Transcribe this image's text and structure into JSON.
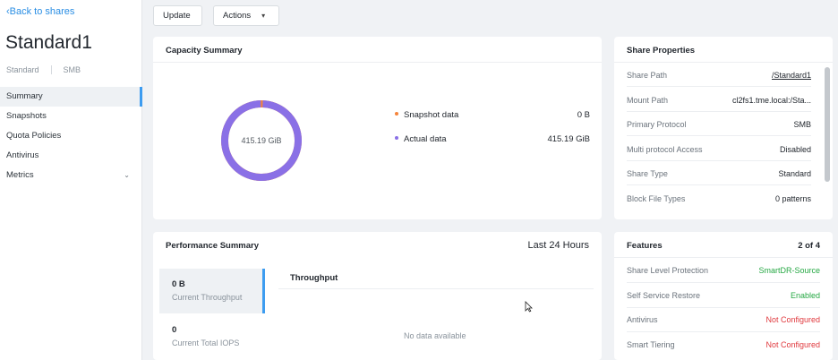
{
  "sidebar": {
    "back_label": "‹Back to shares",
    "title": "Standard1",
    "meta": [
      "Standard",
      "SMB"
    ],
    "items": [
      {
        "label": "Summary",
        "active": true
      },
      {
        "label": "Snapshots"
      },
      {
        "label": "Quota Policies"
      },
      {
        "label": "Antivirus"
      },
      {
        "label": "Metrics",
        "chevron": "chevron-down-icon"
      }
    ]
  },
  "toolbar": {
    "update_label": "Update",
    "actions_label": "Actions"
  },
  "capacity": {
    "title": "Capacity Summary",
    "total": "415.19 GiB",
    "legend": [
      {
        "label": "Snapshot data",
        "value": "0 B",
        "color": "#f5843b"
      },
      {
        "label": "Actual data",
        "value": "415.19 GiB",
        "color": "#8a70e6"
      }
    ],
    "actual_fraction": 1.0
  },
  "properties": {
    "title": "Share Properties",
    "rows": [
      {
        "label": "Share Path",
        "value": "/Standard1"
      },
      {
        "label": "Mount Path",
        "value": "cl2fs1.tme.local:/Sta..."
      },
      {
        "label": "Primary Protocol",
        "value": "SMB"
      },
      {
        "label": "Multi protocol Access",
        "value": "Disabled"
      },
      {
        "label": "Share Type",
        "value": "Standard"
      },
      {
        "label": "Block File Types",
        "value": "0 patterns"
      }
    ]
  },
  "performance": {
    "title": "Performance Summary",
    "range": "Last 24 Hours",
    "metrics": [
      {
        "value": "0 B",
        "label": "Current Throughput",
        "active": true
      },
      {
        "value": "0",
        "label": "Current Total IOPS"
      }
    ],
    "chart_title": "Throughput",
    "no_data": "No data available"
  },
  "features": {
    "title": "Features",
    "count": "2 of 4",
    "rows": [
      {
        "label": "Share Level Protection",
        "value": "SmartDR-Source",
        "color": "#26a844"
      },
      {
        "label": "Self Service Restore",
        "value": "Enabled",
        "color": "#26a844"
      },
      {
        "label": "Antivirus",
        "value": "Not Configured",
        "color": "#e0393e"
      },
      {
        "label": "Smart Tiering",
        "value": "Not Configured",
        "color": "#e0393e"
      }
    ]
  }
}
